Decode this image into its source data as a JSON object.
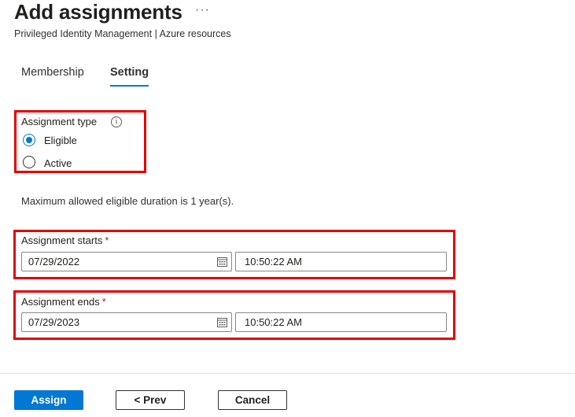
{
  "header": {
    "title": "Add assignments",
    "more_label": "···",
    "subtitle": "Privileged Identity Management | Azure resources"
  },
  "tabs": [
    {
      "label": "Membership",
      "selected": false
    },
    {
      "label": "Setting",
      "selected": true
    }
  ],
  "assignment_type": {
    "label": "Assignment type",
    "info_glyph": "i",
    "options": [
      {
        "label": "Eligible",
        "checked": true
      },
      {
        "label": "Active",
        "checked": false
      }
    ]
  },
  "duration_note": "Maximum allowed eligible duration is 1 year(s).",
  "assignment_starts": {
    "label": "Assignment starts",
    "required_mark": "*",
    "date": "07/29/2022",
    "time": "10:50:22 AM"
  },
  "assignment_ends": {
    "label": "Assignment ends",
    "required_mark": "*",
    "date": "07/29/2023",
    "time": "10:50:22 AM"
  },
  "footer": {
    "assign_label": "Assign",
    "prev_label": "< Prev",
    "cancel_label": "Cancel"
  },
  "colors": {
    "accent": "#0078d4",
    "highlight_box": "#e50000",
    "required": "#a4262c"
  }
}
